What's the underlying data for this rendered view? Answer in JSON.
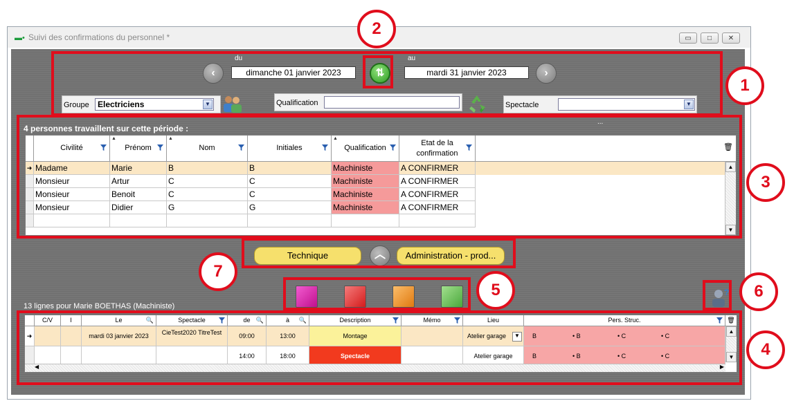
{
  "window": {
    "title": "Suivi des confirmations du personnel *",
    "buttons": {
      "minimize": "▭",
      "maximize": "□",
      "close": "✕"
    }
  },
  "period": {
    "from_label": "du",
    "to_label": "au",
    "from_value": "dimanche 01 janvier 2023",
    "to_value": "mardi 31 janvier 2023"
  },
  "filters": {
    "groupe_label": "Groupe",
    "groupe_value": "Electriciens",
    "qualification_label": "Qualification",
    "qualification_value": "",
    "spectacle_label": "Spectacle",
    "spectacle_value": ""
  },
  "people_grid": {
    "summary": "4 personnes travaillent sur cette période :",
    "ellipsis": "...",
    "columns": [
      "Civilité",
      "Prénom",
      "Nom",
      "Initiales",
      "Qualification",
      "Etat de la confirmation"
    ],
    "rows": [
      [
        "Madame",
        "Marie",
        "B",
        "B",
        "Machiniste",
        "A CONFIRMER"
      ],
      [
        "Monsieur",
        "Artur",
        "C",
        "C",
        "Machiniste",
        "A CONFIRMER"
      ],
      [
        "Monsieur",
        "Benoit",
        "C",
        "C",
        "Machiniste",
        "A CONFIRMER"
      ],
      [
        "Monsieur",
        "Didier",
        "G",
        "G",
        "Machiniste",
        "A CONFIRMER"
      ]
    ]
  },
  "tabs": {
    "left": "Technique",
    "right": "Administration - prod..."
  },
  "colors": {
    "annotation_red": "#e00d1c",
    "highlight_row": "#fbe7c4",
    "qualification_cell": "#f59a9a",
    "description_yellow": "#fbf29a",
    "spectacle_red": "#f23a1e",
    "pers_struc_pink": "#f7a6a6",
    "color_buttons": [
      "#e01ea8",
      "#e82e2e",
      "#f28a1a",
      "#5cc04a"
    ]
  },
  "schedule": {
    "summary": "13 lignes pour Marie  BOETHAS (Machiniste)",
    "columns": [
      "C/V",
      "I",
      "Le",
      "Spectacle",
      "de",
      "à",
      "Description",
      "Mémo",
      "Lieu",
      "Pers. Struc."
    ],
    "rows": [
      {
        "le": "mardi 03 janvier 2023",
        "spectacle": "CieTest2020 TitreTest",
        "de": "09:00",
        "a": "13:00",
        "description": "Montage",
        "memo": "",
        "lieu": "Atelier garage",
        "pers": [
          "B",
          "• B",
          "• C",
          "• C"
        ]
      },
      {
        "le": "",
        "spectacle": "",
        "de": "14:00",
        "a": "18:00",
        "description": "Spectacle",
        "memo": "",
        "lieu": "Atelier garage",
        "pers": [
          "B",
          "• B",
          "• C",
          "• C"
        ]
      }
    ]
  },
  "callouts": [
    "1",
    "2",
    "3",
    "4",
    "5",
    "6",
    "7"
  ]
}
